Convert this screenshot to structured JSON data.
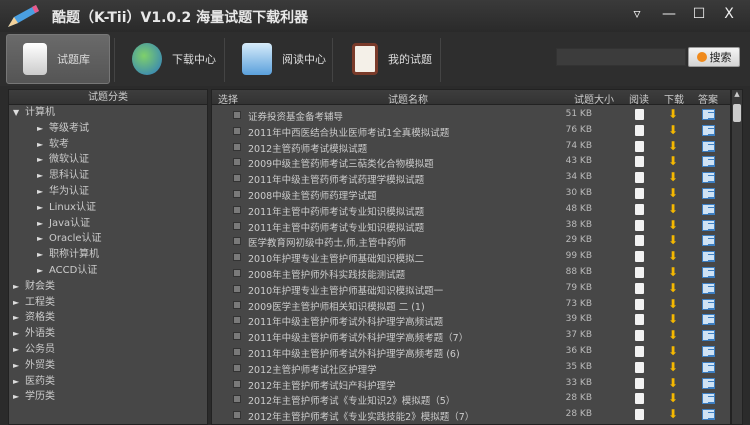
{
  "app": {
    "title": "酷题（K-Tii）V1.0.2 海量试题下载利器"
  },
  "window": {
    "menu": "▿",
    "minimize": "—",
    "maximize": "☐",
    "close": "X"
  },
  "toolbar": {
    "tabs": [
      {
        "label": "试题库",
        "icon": "documents-icon",
        "active": true
      },
      {
        "label": "下载中心",
        "icon": "globe-download-icon"
      },
      {
        "label": "阅读中心",
        "icon": "magnifier-icon"
      },
      {
        "label": "我的试题",
        "icon": "clipboard-icon"
      }
    ],
    "search_value": "",
    "search_button": "搜索"
  },
  "tree": {
    "header": "试题分类",
    "items": [
      {
        "label": "计算机",
        "level": 0,
        "expanded": true
      },
      {
        "label": "等级考试",
        "level": 1
      },
      {
        "label": "软考",
        "level": 1
      },
      {
        "label": "微软认证",
        "level": 1
      },
      {
        "label": "思科认证",
        "level": 1
      },
      {
        "label": "华为认证",
        "level": 1
      },
      {
        "label": "Linux认证",
        "level": 1
      },
      {
        "label": "Java认证",
        "level": 1
      },
      {
        "label": "Oracle认证",
        "level": 1
      },
      {
        "label": "职称计算机",
        "level": 1
      },
      {
        "label": "ACCD认证",
        "level": 1
      },
      {
        "label": "财会类",
        "level": 0
      },
      {
        "label": "工程类",
        "level": 0
      },
      {
        "label": "资格类",
        "level": 0
      },
      {
        "label": "外语类",
        "level": 0
      },
      {
        "label": "公务员",
        "level": 0
      },
      {
        "label": "外贸类",
        "level": 0
      },
      {
        "label": "医药类",
        "level": 0
      },
      {
        "label": "学历类",
        "level": 0
      }
    ]
  },
  "table": {
    "headers": {
      "select": "选择",
      "name": "试题名称",
      "size": "试题大小",
      "read": "阅读",
      "download": "下载",
      "answer": "答案"
    },
    "rows": [
      {
        "name": "证券投资基金备考辅导",
        "size": "51 KB"
      },
      {
        "name": " 2011年中西医结合执业医师考试1全真模拟试题",
        "size": "76 KB"
      },
      {
        "name": "2012主管药师考试模拟试题",
        "size": "74 KB"
      },
      {
        "name": "2009中级主管药师考试三萜类化合物模拟题",
        "size": "43 KB"
      },
      {
        "name": "2011年中级主管药师考试药理学模拟试题",
        "size": "34 KB"
      },
      {
        "name": "2008中级主管药师药理学试题",
        "size": "30 KB"
      },
      {
        "name": "2011年主管中药师考试专业知识模拟试题",
        "size": "48 KB"
      },
      {
        "name": "2011年主管中药师考试专业知识模拟试题",
        "size": "38 KB"
      },
      {
        "name": "医学教育网初级中药士,师,主管中药师",
        "size": "29 KB"
      },
      {
        "name": "2010年护理专业主管护师基础知识模拟二",
        "size": "99 KB"
      },
      {
        "name": "2008年主管护师外科实践技能测试题",
        "size": "88 KB"
      },
      {
        "name": "2010年护理专业主管护师基础知识模拟试题一",
        "size": "79 KB"
      },
      {
        "name": "2009医学主管护师相关知识模拟题 二 (1)",
        "size": "73 KB"
      },
      {
        "name": "2011年中级主管护师考试外科护理学高频试题",
        "size": "39 KB"
      },
      {
        "name": "2011年中级主管护师考试外科护理学高频考题（7）",
        "size": "37 KB"
      },
      {
        "name": "2011年中级主管护师考试外科护理学高频考题 (6)",
        "size": "36 KB"
      },
      {
        "name": "2012主管护师考试社区护理学",
        "size": "35 KB"
      },
      {
        "name": "2012年主管护师考试妇产科护理学",
        "size": "33 KB"
      },
      {
        "name": "2012年主管护师考试《专业知识2》模拟题（5）",
        "size": "28 KB"
      },
      {
        "name": "2012年主管护师考试《专业实践技能2》模拟题（7）",
        "size": "28 KB"
      }
    ]
  }
}
